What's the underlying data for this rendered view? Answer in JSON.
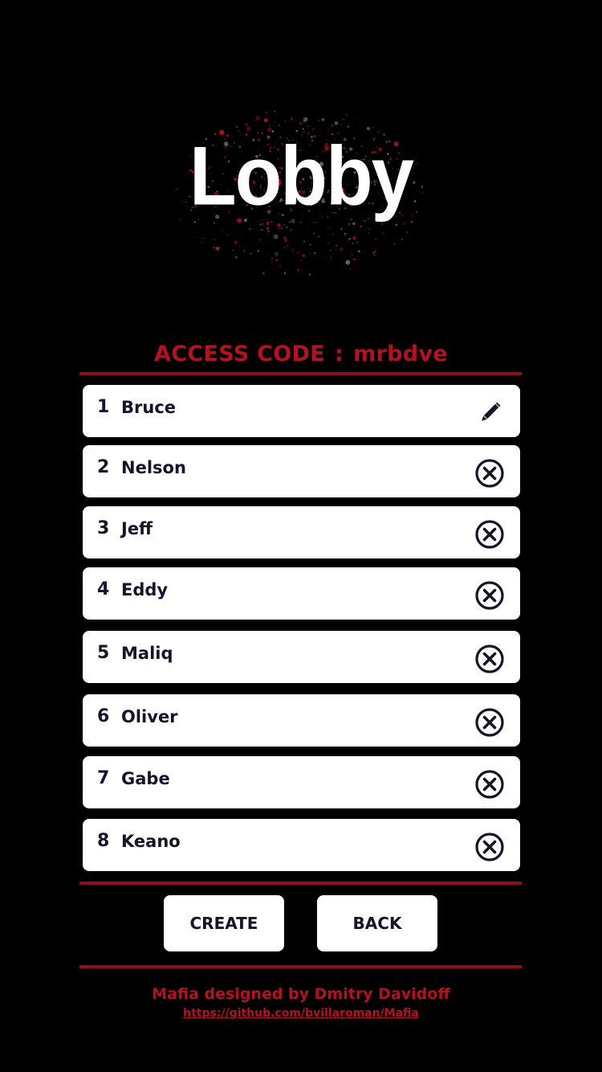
{
  "header": {
    "title": "Lobby"
  },
  "access": {
    "label": "ACCESS CODE",
    "separator": ":",
    "code": "mrbdve"
  },
  "players": [
    {
      "number": "1",
      "name": "Bruce",
      "action_icon": "pencil-icon"
    },
    {
      "number": "2",
      "name": "Nelson",
      "action_icon": "remove-circle-x-icon"
    },
    {
      "number": "3",
      "name": "Jeff",
      "action_icon": "remove-circle-x-icon"
    },
    {
      "number": "4",
      "name": "Eddy",
      "action_icon": "remove-circle-x-icon"
    },
    {
      "number": "5",
      "name": "Maliq",
      "action_icon": "remove-circle-x-icon"
    },
    {
      "number": "6",
      "name": "Oliver",
      "action_icon": "remove-circle-x-icon"
    },
    {
      "number": "7",
      "name": "Gabe",
      "action_icon": "remove-circle-x-icon"
    },
    {
      "number": "8",
      "name": "Keano",
      "action_icon": "remove-circle-x-icon"
    }
  ],
  "buttons": {
    "create_label": "CREATE",
    "back_label": "BACK"
  },
  "footer": {
    "credit": "Mafia designed by Dmitry Davidoff",
    "link_text": "https://github.com/bvillaroman/Mafia"
  },
  "colors": {
    "background": "#000000",
    "accent_red": "#b31222",
    "rule_red": "#8e0e1c",
    "card_white": "#ffffff",
    "text_dark": "#14152b"
  }
}
